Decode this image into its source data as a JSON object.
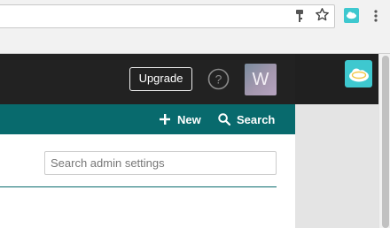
{
  "browser": {
    "icons": [
      "key-icon",
      "star-icon",
      "extension-cloud-icon",
      "kebab-menu-icon"
    ]
  },
  "topbar": {
    "upgrade_label": "Upgrade",
    "help_icon": "help-circle-icon",
    "avatar_letter": "W"
  },
  "actionbar": {
    "new_label": "New",
    "search_label": "Search"
  },
  "main": {
    "search_placeholder": "Search admin settings"
  },
  "colors": {
    "topbar": "#222222",
    "actionbar": "#086a6d",
    "accent_cloud": "#3ec8cf",
    "divider": "#086a6d"
  }
}
